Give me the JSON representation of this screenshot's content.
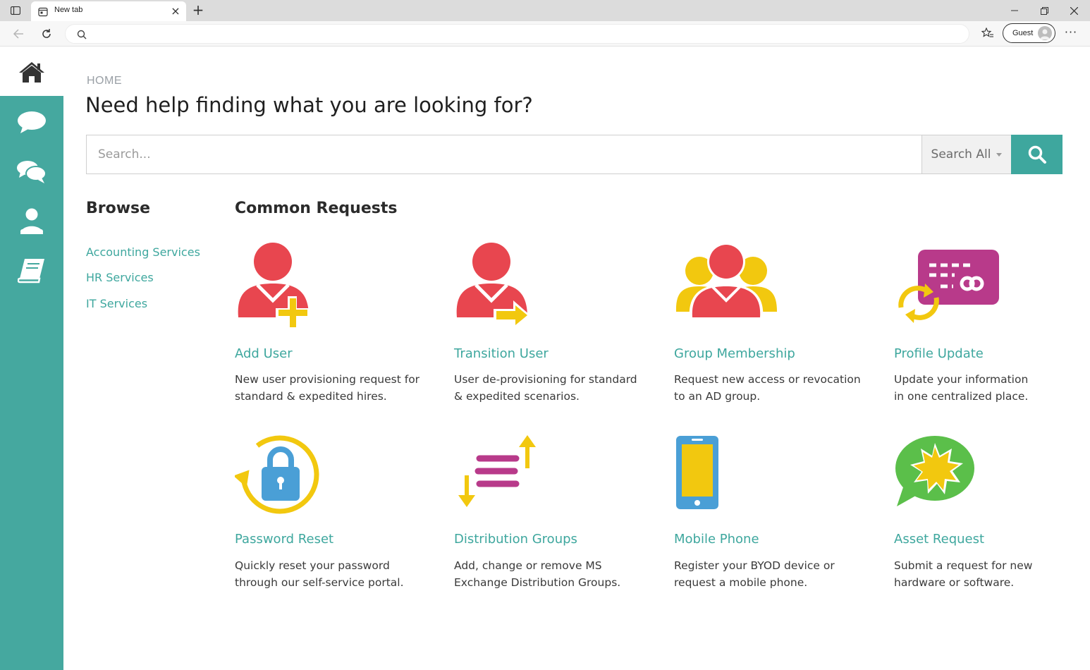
{
  "browser": {
    "tab_title": "New tab",
    "guest_label": "Guest",
    "omnibox_value": ""
  },
  "sidebar": {
    "items": [
      {
        "name": "home",
        "icon": "home-icon"
      },
      {
        "name": "chat",
        "icon": "chat-icon"
      },
      {
        "name": "conversations",
        "icon": "comments-icon"
      },
      {
        "name": "profile",
        "icon": "user-icon"
      },
      {
        "name": "knowledge",
        "icon": "book-icon"
      }
    ]
  },
  "breadcrumb": "HOME",
  "page_title": "Need help finding what you are looking for?",
  "search": {
    "placeholder": "Search...",
    "value": "",
    "scope_label": "Search All",
    "button_icon": "search-icon"
  },
  "browse": {
    "title": "Browse",
    "links": [
      "Accounting Services",
      "HR Services",
      "IT Services"
    ]
  },
  "common_requests": {
    "title": "Common Requests",
    "cards": [
      {
        "title": "Add User",
        "desc_line1": "New user provisioning request for",
        "desc_line2": "standard & expedited hires.",
        "icon": "add-user-icon"
      },
      {
        "title": "Transition User",
        "desc_line1": "User de-provisioning for standard",
        "desc_line2": "& expedited scenarios.",
        "icon": "transition-user-icon"
      },
      {
        "title": "Group Membership",
        "desc_line1": "Request new access or revocation",
        "desc_line2": "to an AD group.",
        "icon": "group-membership-icon"
      },
      {
        "title": "Profile Update",
        "desc_line1": "Update your information",
        "desc_line2": "in one centralized place.",
        "icon": "profile-update-icon"
      },
      {
        "title": "Password Reset",
        "desc_line1": "Quickly reset your password",
        "desc_line2": "through our self-service portal.",
        "icon": "password-reset-icon"
      },
      {
        "title": "Distribution Groups",
        "desc_line1": "Add, change or remove MS",
        "desc_line2": "Exchange Distribution Groups.",
        "icon": "distribution-groups-icon"
      },
      {
        "title": "Mobile Phone",
        "desc_line1": "Register your BYOD device or",
        "desc_line2": "request a mobile phone.",
        "icon": "mobile-phone-icon"
      },
      {
        "title": "Asset Request",
        "desc_line1": "Submit a request for new",
        "desc_line2": "hardware or software.",
        "icon": "asset-request-icon"
      }
    ]
  },
  "colors": {
    "accent": "#3ea79e",
    "sidebar": "#45a89f",
    "red": "#e8464f",
    "yellow": "#f2c80f",
    "magenta": "#b83a8a",
    "blue": "#4a9fd6",
    "green": "#5bbf4a"
  }
}
